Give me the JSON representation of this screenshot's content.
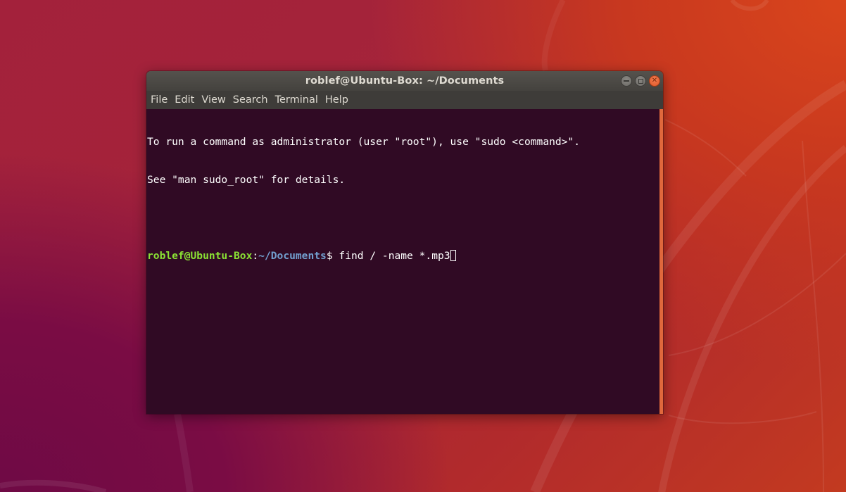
{
  "window": {
    "title": "roblef@Ubuntu-Box: ~/Documents",
    "controls": {
      "minimize_icon": "minimize-icon",
      "maximize_icon": "maximize-icon",
      "close_icon": "close-icon"
    }
  },
  "menubar": {
    "items": [
      "File",
      "Edit",
      "View",
      "Search",
      "Terminal",
      "Help"
    ]
  },
  "terminal": {
    "lines": [
      "To run a command as administrator (user \"root\"), use \"sudo <command>\".",
      "See \"man sudo_root\" for details.",
      ""
    ],
    "prompt": {
      "user_host": "roblef@Ubuntu-Box",
      "separator": ":",
      "path": "~/Documents",
      "symbol": "$",
      "command": " find / -name *.mp3"
    },
    "colors": {
      "background": "#300a24",
      "foreground": "#ffffff",
      "user_host": "#8ae234",
      "path": "#729fcf",
      "scrollbar_thumb": "#e0683c"
    }
  }
}
